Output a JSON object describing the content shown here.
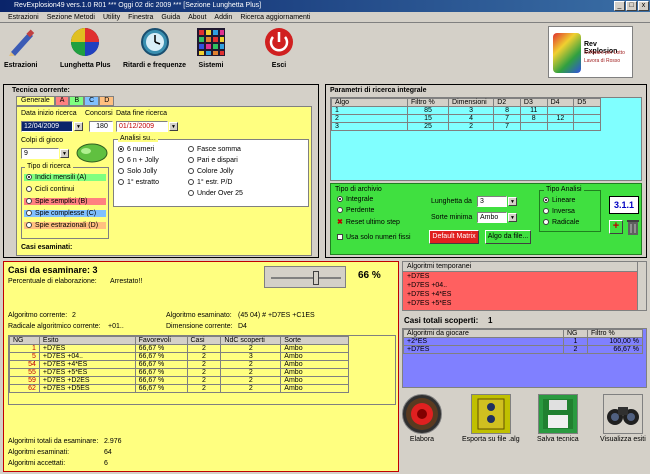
{
  "window": {
    "title": "RevExplosion49 vers.1.0 R01  ***  Oggi 02 dic 2009  ***  [Sezione Lunghetta Plus]",
    "buttons": [
      "_",
      "□",
      "x"
    ]
  },
  "menu": [
    "Estrazioni",
    "Sezione Metodi",
    "Utility",
    "Finestra",
    "Guida",
    "About",
    "Addin",
    "Ricerca aggiornamenti"
  ],
  "toolbar": [
    {
      "label": "Estrazioni",
      "icon": "pencil-icon"
    },
    {
      "label": "Lunghetta Plus",
      "icon": "color-wheel-icon"
    },
    {
      "label": "Ritardi e frequenze",
      "icon": "clock-icon"
    },
    {
      "label": "Sistemi",
      "icon": "grid-icon"
    },
    {
      "label": "Esci",
      "icon": "power-icon"
    }
  ],
  "logo": {
    "line1": "Rev Explosion",
    "line2": "Software per Lotto",
    "line3": "Lavora di Rosso"
  },
  "tecnica": {
    "title": "Tecnica corrente:",
    "tabs": [
      "Generale",
      "A",
      "B",
      "C",
      "D"
    ],
    "data_inizio_label": "Data inizio ricerca",
    "data_inizio_value": "12/04/2009",
    "concorsi_label": "Concorsi",
    "concorsi_value": "180",
    "data_fine_label": "Data fine ricerca",
    "data_fine_value": "01/12/2009",
    "colpi_label": "Colpi di gioco",
    "colpi_value": "9",
    "analisi_label": "Analisi su...",
    "analisi_col1": [
      "6 numeri",
      "6 n + Jolly",
      "Solo Jolly",
      "1° estratto"
    ],
    "analisi_col2": [
      "Fasce somma",
      "Pari e dispari",
      "Colore Jolly",
      "1° estr. P/D",
      "Under Over 25"
    ],
    "tipo_label": "Tipo di ricerca",
    "tipo_options": [
      "Indici mensili (A)",
      "Cicli continui",
      "Spie semplici (B)",
      "Spie complesse (C)",
      "Spie estrazionali (D)"
    ],
    "casi_label": "Casi esaminati:"
  },
  "parametri": {
    "title": "Parametri di ricerca integrale",
    "headers": [
      "Algo",
      "Filtro %",
      "Dimensioni",
      "D2",
      "D3",
      "D4",
      "D5"
    ],
    "rows": [
      [
        "1",
        "85",
        "3",
        "8",
        "11",
        "",
        ""
      ],
      [
        "2",
        "15",
        "4",
        "7",
        "8",
        "12",
        ""
      ],
      [
        "3",
        "25",
        "2",
        "7",
        "",
        "",
        ""
      ]
    ]
  },
  "archivio": {
    "title": "Tipo di archivio",
    "options": [
      "Integrale",
      "Perdente"
    ],
    "reset_label": "Reset ultimo step",
    "fissi_label": "Usa solo numeri fissi",
    "lunghetta_label": "Lunghetta da",
    "lunghetta_value": "3",
    "sorte_label": "Sorte minima",
    "sorte_value": "Ambo",
    "tipo_analisi_label": "Tipo Analisi",
    "tipo_analisi_options": [
      "Lineare",
      "Inversa",
      "Radicale"
    ],
    "version": "3.1.1",
    "default_btn": "Default Matrix",
    "algo_btn": "Algo da file..."
  },
  "esame": {
    "casi_title": "Casi da esaminare: 3",
    "percentuale_label": "Percentuale di elaborazione:",
    "percentuale_value": "Arrestato!!",
    "percent": "66 %",
    "slider_level": 0.66,
    "algo_corrente_label": "Algoritmo corrente:",
    "algo_corrente_value": "2",
    "algo_esaminato_label": "Algoritmo esaminato:",
    "algo_esaminato_value": "(45 04) # +D7ES +C1ES",
    "radicale_label": "Radicale algoritmico corrente:",
    "radicale_value": "+01..",
    "dimensione_label": "Dimensione corrente:",
    "dimensione_value": "D4",
    "headers": [
      "NG",
      "Esito",
      "Favorevoli",
      "Casi",
      "NdC scoperti",
      "Sorte"
    ],
    "rows": [
      [
        "1",
        "+D7ES",
        "66,67 %",
        "2",
        "2",
        "Ambo"
      ],
      [
        "5",
        "+D7ES +04..",
        "66,67 %",
        "2",
        "3",
        "Ambo"
      ],
      [
        "54",
        "+D7ES +4*ES",
        "66,67 %",
        "2",
        "2",
        "Ambo"
      ],
      [
        "55",
        "+D7ES +5*ES",
        "66,67 %",
        "2",
        "2",
        "Ambo"
      ],
      [
        "59",
        "+D7ES +D2ES",
        "66,67 %",
        "2",
        "2",
        "Ambo"
      ],
      [
        "62",
        "+D7ES +D5ES",
        "66,67 %",
        "2",
        "2",
        "Ambo"
      ]
    ],
    "totali_label": "Algoritmi totali da esaminare:",
    "totali_value": "2.976",
    "esaminati_label": "Algoritmi esaminati:",
    "esaminati_value": "64",
    "accettati_label": "Algoritmi accettati:",
    "accettati_value": "6"
  },
  "temporanei": {
    "header": "Algoritmi temporanei",
    "items": [
      "+D7ES",
      "+D7ES +04..",
      "+D7ES +4*ES",
      "+D7ES +5*ES"
    ]
  },
  "scoperti": {
    "label": "Casi totali scoperti:",
    "value": "1",
    "headers": [
      "Algoritmi da giocare",
      "NG",
      "Filtro %"
    ],
    "rows": [
      [
        "+2*ES",
        "1",
        "100,00 %"
      ],
      [
        "+D7ES",
        "2",
        "66,67 %"
      ]
    ]
  },
  "actions": [
    {
      "label": "Elabora",
      "icon": "record-icon"
    },
    {
      "label": "Esporta su file .alg",
      "icon": "export-icon"
    },
    {
      "label": "Salva tecnica",
      "icon": "floppy-icon"
    },
    {
      "label": "Visualizza esiti",
      "icon": "binoculars-icon"
    }
  ]
}
